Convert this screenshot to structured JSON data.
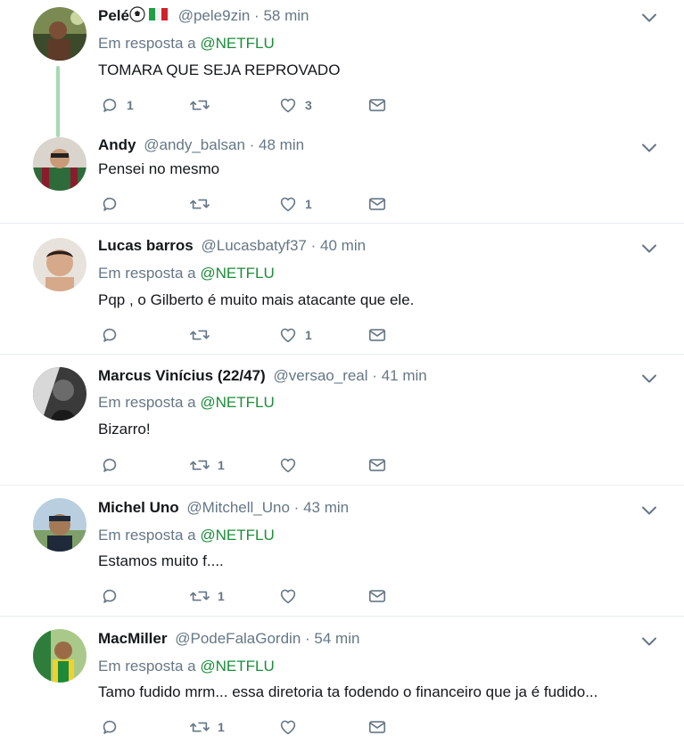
{
  "colors": {
    "mention": "#1b8d3a",
    "thread_line": "#a8d8b1",
    "muted": "#657786"
  },
  "icons": [
    "reply-icon",
    "retweet-icon",
    "like-icon",
    "direct-message-icon",
    "chevron-down-icon"
  ],
  "tweets": [
    {
      "name": "Pelé",
      "handle": "@pele9zin",
      "time": "58 min",
      "reply_prefix": "Em resposta a",
      "reply_mention": "@NETFLU",
      "text": "TOMARA QUE SEJA REPROVADO",
      "replies": "1",
      "retweets": "",
      "likes": "3"
    },
    {
      "name": "Andy",
      "handle": "@andy_balsan",
      "time": "48 min",
      "reply_prefix": "",
      "reply_mention": "",
      "text": "Pensei no mesmo",
      "replies": "",
      "retweets": "",
      "likes": "1"
    },
    {
      "name": "Lucas barros",
      "handle": "@Lucasbatyf37",
      "time": "40 min",
      "reply_prefix": "Em resposta a",
      "reply_mention": "@NETFLU",
      "text": "Pqp , o Gilberto é muito mais atacante que ele.",
      "replies": "",
      "retweets": "",
      "likes": "1"
    },
    {
      "name": "Marcus Vinícius (22/47)",
      "handle": "@versao_real",
      "time": "41 min",
      "reply_prefix": "Em resposta a",
      "reply_mention": "@NETFLU",
      "text": "Bizarro!",
      "replies": "",
      "retweets": "1",
      "likes": ""
    },
    {
      "name": "Michel Uno",
      "handle": "@Mitchell_Uno",
      "time": "43 min",
      "reply_prefix": "Em resposta a",
      "reply_mention": "@NETFLU",
      "text": "Estamos muito f....",
      "replies": "",
      "retweets": "1",
      "likes": ""
    },
    {
      "name": "MacMiller",
      "handle": "@PodeFalaGordin",
      "time": "54 min",
      "reply_prefix": "Em resposta a",
      "reply_mention": "@NETFLU",
      "text": "Tamo fudido mrm... essa diretoria ta fodendo o financeiro que ja é fudido...",
      "replies": "",
      "retweets": "1",
      "likes": ""
    }
  ],
  "separator": "·"
}
